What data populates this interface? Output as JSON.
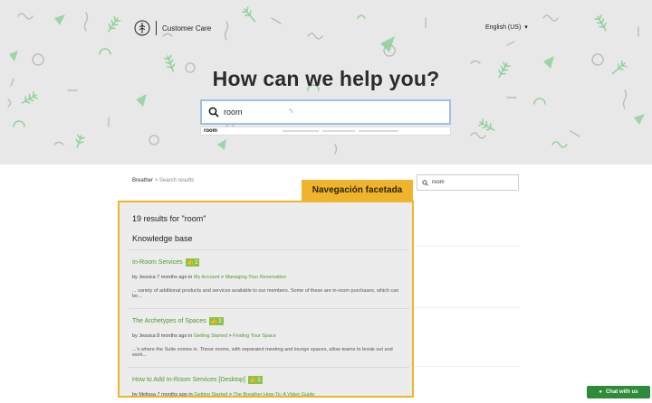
{
  "header": {
    "brand_name": "Customer Care",
    "language": "English (US)"
  },
  "hero": {
    "title": "How can we help you?",
    "search_value": "room",
    "suggestion": "room"
  },
  "breadcrumb": {
    "root": "Breather",
    "separator": ">",
    "current": "Search results"
  },
  "side_search": {
    "value": "room"
  },
  "annotation": {
    "label": "Navegación facetada"
  },
  "results": {
    "count_text": "19 results for \"room\"",
    "section_heading": "Knowledge base",
    "items": [
      {
        "title": "In-Room Services",
        "votes": "1",
        "meta_prefix": "by Jessica 7 months ago in ",
        "category": "My Account",
        "sep": " > ",
        "section": "Managing Your Reservation",
        "snippet": "... variety of additional products and services available to our members. Some of these are in-room purchases, which can be..."
      },
      {
        "title": "The Archetypes of Spaces",
        "votes": "2",
        "meta_prefix": "by Jessica 8 months ago in ",
        "category": "Getting Started",
        "sep": " > ",
        "section": "Finding Your Space",
        "snippet": "...'s where the Suite comes in. These rooms, with separated meeting and lounge spaces, allow teams to break out and work..."
      },
      {
        "title": "How to Add In-Room Services [Desktop]",
        "votes": "1",
        "meta_prefix": "by Melissa 7 months ago in ",
        "category": "Getting Started",
        "sep": " > ",
        "section": "The Breather How-To: A Video Guide",
        "snippet": ""
      }
    ]
  },
  "chat": {
    "label": "Chat with us"
  },
  "colors": {
    "accent_green": "#4e9a2b",
    "vote_green": "#8bc34a",
    "highlight": "#f0b42c",
    "chat_green": "#2e8b3a"
  }
}
